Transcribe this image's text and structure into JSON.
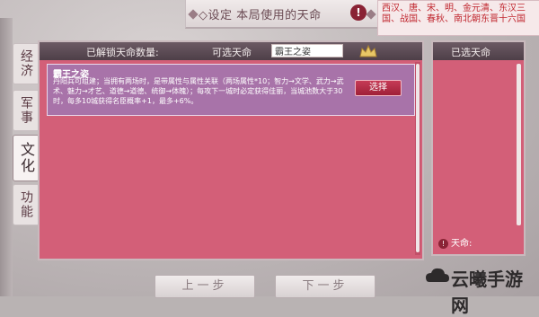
{
  "topbar": {
    "title": "◇设定 本局使用的天命",
    "warning_icon": "!",
    "dynasties": "西汉、唐、宋、明、金元清、东汉三国、战国、春秋、南北朝东晋十六国"
  },
  "left_tabs": [
    {
      "label": "经济",
      "active": false
    },
    {
      "label": "军事",
      "active": false
    },
    {
      "label": "文化",
      "active": true
    },
    {
      "label": "功能",
      "active": false
    }
  ],
  "main": {
    "unlocked_label": "已解锁天命数量:",
    "selectable_label": "可选天命",
    "search_value": "霸王之姿",
    "card": {
      "title": "霸王之姿",
      "description": "丹阳兵可组建；当拥有两场时，是带属性与属性关联（两场属性*10；智力→文学、武力→武术、魅力→才艺、道德→道德、统御→体魄）；每攻下一城时必定获得佳丽，当城池数大于30时，每多10城获得名臣概率+1，最多+6%。",
      "button_label": "选择"
    }
  },
  "right": {
    "title": "已选天命",
    "footer_label": "天命:"
  },
  "nav": {
    "prev_label": "上一步",
    "next_label": "下一步"
  },
  "watermark": {
    "text": "云曦手游网"
  }
}
